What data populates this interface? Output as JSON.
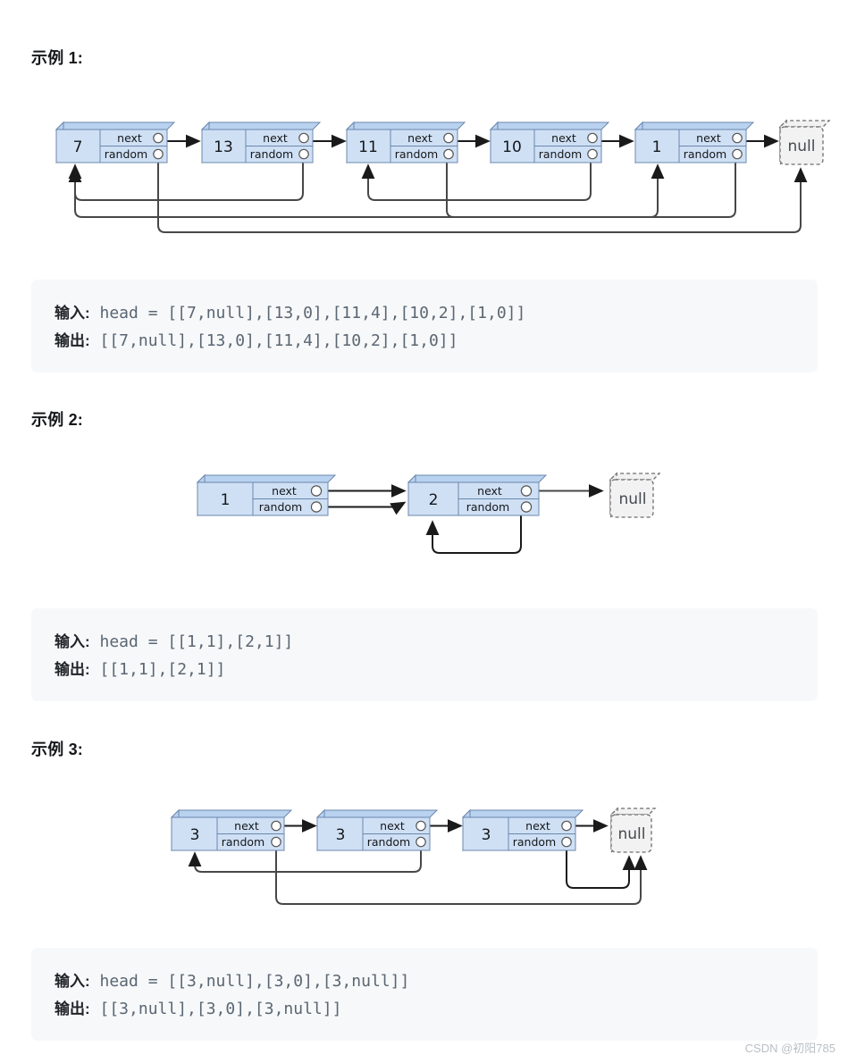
{
  "page": {
    "watermark": "CSDN @初阳785",
    "background": "#ffffff",
    "node_fill": "#cfe0f5",
    "node_top_fill": "#b9d2ef",
    "node_side_fill": "#b9d2ef",
    "node_stroke": "#6b87ad",
    "null_fill": "#f2f2f2",
    "null_stroke": "#6d6d6d",
    "arrow_color": "#1a1a1a",
    "code_bg": "#f7f8f9",
    "code_color": "#5a6673"
  },
  "examples": [
    {
      "heading": "示例 1:",
      "input_label": "输入:",
      "output_label": "输出:",
      "input_value": " head = [[7,null],[13,0],[11,4],[10,2],[1,0]]",
      "output_value": " [[7,null],[13,0],[11,4],[10,2],[1,0]]",
      "diagram": {
        "next_field_label": "next",
        "random_field_label": "random",
        "null_label": "null",
        "nodes": [
          {
            "value": "7",
            "random_target": "null"
          },
          {
            "value": "13",
            "random_target": "0"
          },
          {
            "value": "11",
            "random_target": "4"
          },
          {
            "value": "10",
            "random_target": "2"
          },
          {
            "value": "1",
            "random_target": "0"
          }
        ]
      }
    },
    {
      "heading": "示例 2:",
      "input_label": "输入:",
      "output_label": "输出:",
      "input_value": " head = [[1,1],[2,1]]",
      "output_value": " [[1,1],[2,1]]",
      "diagram": {
        "next_field_label": "next",
        "random_field_label": "random",
        "null_label": "null",
        "nodes": [
          {
            "value": "1",
            "random_target": "1"
          },
          {
            "value": "2",
            "random_target": "1"
          }
        ]
      }
    },
    {
      "heading": "示例 3:",
      "input_label": "输入:",
      "output_label": "输出:",
      "input_value": " head = [[3,null],[3,0],[3,null]]",
      "output_value": " [[3,null],[3,0],[3,null]]",
      "diagram": {
        "next_field_label": "next",
        "random_field_label": "random",
        "null_label": "null",
        "nodes": [
          {
            "value": "3",
            "random_target": "null"
          },
          {
            "value": "3",
            "random_target": "0"
          },
          {
            "value": "3",
            "random_target": "null"
          }
        ]
      }
    }
  ]
}
